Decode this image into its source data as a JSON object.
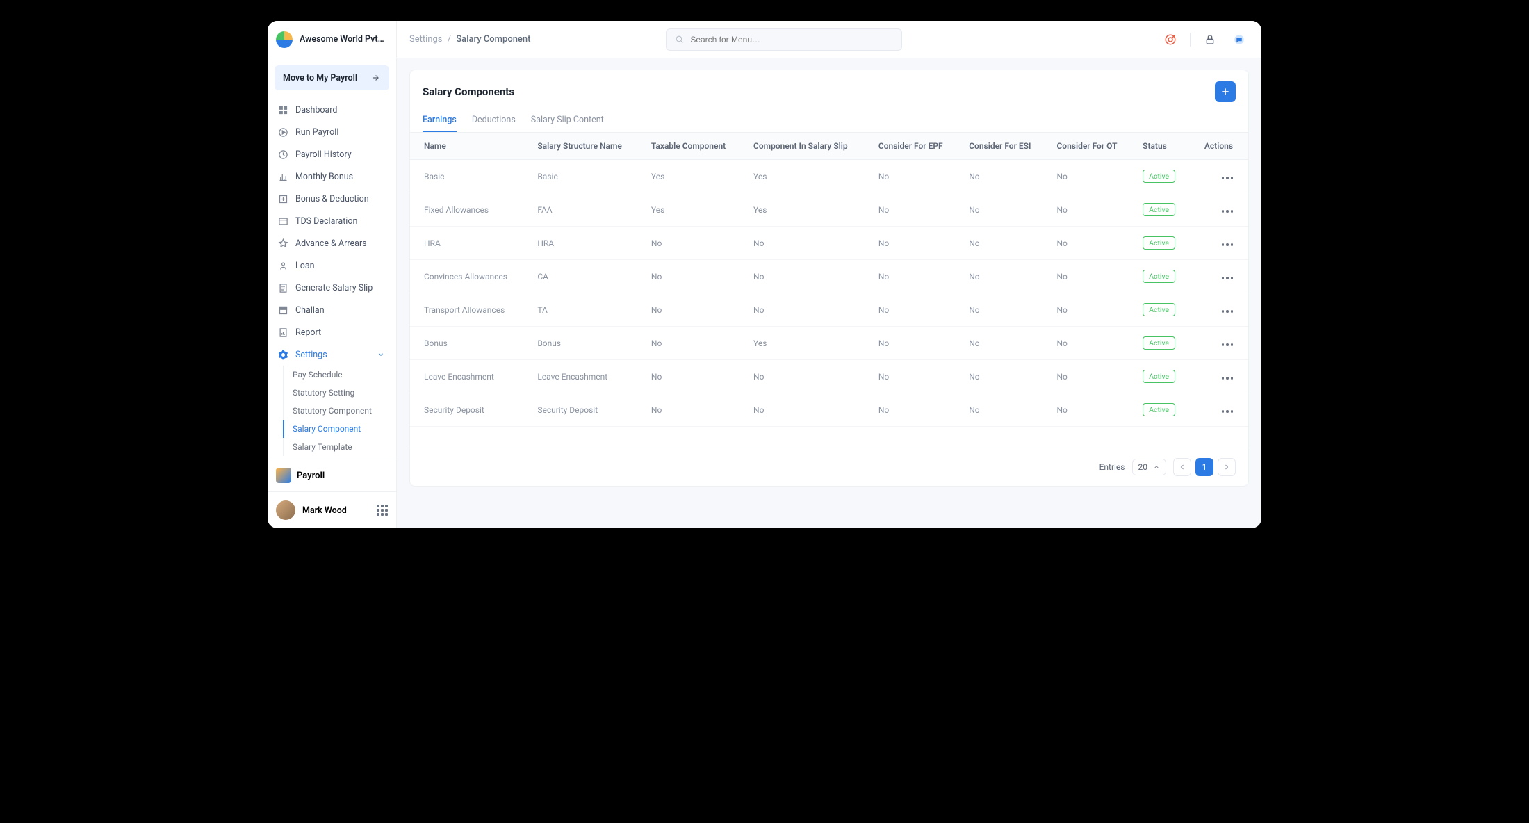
{
  "brand": {
    "company": "Awesome World Pvt…"
  },
  "move_button": "Move to My Payroll",
  "sidebar": {
    "items": [
      {
        "label": "Dashboard",
        "icon": "dashboard-icon"
      },
      {
        "label": "Run Payroll",
        "icon": "run-payroll-icon"
      },
      {
        "label": "Payroll History",
        "icon": "history-icon"
      },
      {
        "label": "Monthly Bonus",
        "icon": "bonus-icon"
      },
      {
        "label": "Bonus & Deduction",
        "icon": "deduction-icon"
      },
      {
        "label": "TDS Declaration",
        "icon": "tds-icon"
      },
      {
        "label": "Advance & Arrears",
        "icon": "advance-icon"
      },
      {
        "label": "Loan",
        "icon": "loan-icon"
      },
      {
        "label": "Generate Salary Slip",
        "icon": "slip-icon"
      },
      {
        "label": "Challan",
        "icon": "challan-icon"
      },
      {
        "label": "Report",
        "icon": "report-icon"
      },
      {
        "label": "Settings",
        "icon": "gear-icon",
        "active": true
      }
    ],
    "settings_children": [
      {
        "label": "Pay Schedule"
      },
      {
        "label": "Statutory Setting"
      },
      {
        "label": "Statutory Component"
      },
      {
        "label": "Salary Component",
        "active": true
      },
      {
        "label": "Salary Template"
      }
    ]
  },
  "module": {
    "name": "Payroll"
  },
  "user": {
    "name": "Mark Wood"
  },
  "breadcrumb": {
    "root": "Settings",
    "sep": "/",
    "current": "Salary Component"
  },
  "search": {
    "placeholder": "Search for Menu…"
  },
  "page": {
    "title": "Salary Components",
    "tabs": [
      {
        "label": "Earnings",
        "active": true
      },
      {
        "label": "Deductions"
      },
      {
        "label": "Salary Slip Content"
      }
    ],
    "columns": [
      "Name",
      "Salary Structure Name",
      "Taxable Component",
      "Component In Salary Slip",
      "Consider For EPF",
      "Consider For ESI",
      "Consider For OT",
      "Status",
      "Actions"
    ],
    "rows": [
      {
        "name": "Basic",
        "struct": "Basic",
        "taxable": "Yes",
        "slip": "Yes",
        "epf": "No",
        "esi": "No",
        "ot": "No",
        "status": "Active"
      },
      {
        "name": "Fixed Allowances",
        "struct": "FAA",
        "taxable": "Yes",
        "slip": "Yes",
        "epf": "No",
        "esi": "No",
        "ot": "No",
        "status": "Active"
      },
      {
        "name": "HRA",
        "struct": "HRA",
        "taxable": "No",
        "slip": "No",
        "epf": "No",
        "esi": "No",
        "ot": "No",
        "status": "Active"
      },
      {
        "name": "Convinces Allowances",
        "struct": "CA",
        "taxable": "No",
        "slip": "No",
        "epf": "No",
        "esi": "No",
        "ot": "No",
        "status": "Active"
      },
      {
        "name": "Transport Allowances",
        "struct": "TA",
        "taxable": "No",
        "slip": "No",
        "epf": "No",
        "esi": "No",
        "ot": "No",
        "status": "Active"
      },
      {
        "name": "Bonus",
        "struct": "Bonus",
        "taxable": "No",
        "slip": "Yes",
        "epf": "No",
        "esi": "No",
        "ot": "No",
        "status": "Active"
      },
      {
        "name": "Leave Encashment",
        "struct": "Leave Encashment",
        "taxable": "No",
        "slip": "No",
        "epf": "No",
        "esi": "No",
        "ot": "No",
        "status": "Active"
      },
      {
        "name": "Security Deposit",
        "struct": "Security Deposit",
        "taxable": "No",
        "slip": "No",
        "epf": "No",
        "esi": "No",
        "ot": "No",
        "status": "Active"
      }
    ]
  },
  "pagination": {
    "label": "Entries",
    "per_page": "20",
    "current": "1"
  }
}
